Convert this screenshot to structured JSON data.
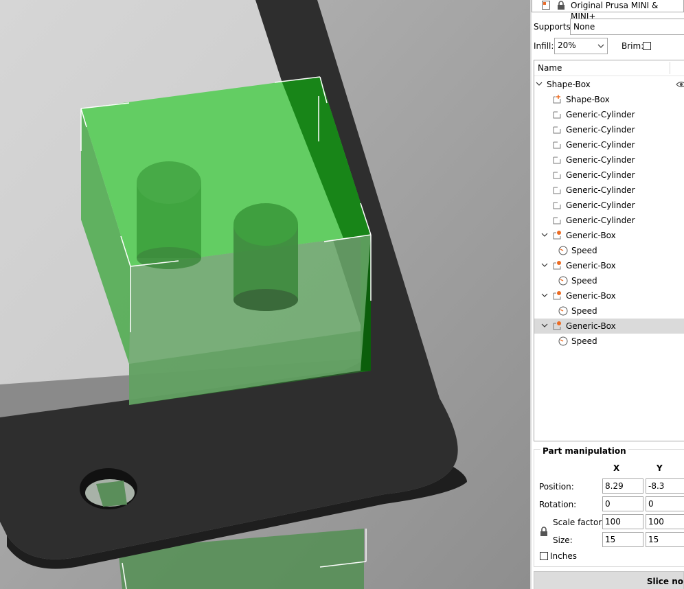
{
  "printer": {
    "name": "Original Prusa MINI & MINI+"
  },
  "supports": {
    "label": "Supports:",
    "value": "None"
  },
  "infill": {
    "label": "Infill:",
    "value": "20%"
  },
  "brim": {
    "label": "Brim:",
    "checked": false
  },
  "object_list": {
    "header": "Name",
    "items": [
      {
        "label": "Shape-Box",
        "type": "object"
      },
      {
        "label": "Shape-Box",
        "type": "part"
      },
      {
        "label": "Generic-Cylinder",
        "type": "modifier"
      },
      {
        "label": "Generic-Cylinder",
        "type": "modifier"
      },
      {
        "label": "Generic-Cylinder",
        "type": "modifier"
      },
      {
        "label": "Generic-Cylinder",
        "type": "modifier"
      },
      {
        "label": "Generic-Cylinder",
        "type": "modifier"
      },
      {
        "label": "Generic-Cylinder",
        "type": "modifier"
      },
      {
        "label": "Generic-Cylinder",
        "type": "modifier"
      },
      {
        "label": "Generic-Cylinder",
        "type": "modifier"
      },
      {
        "label": "Generic-Box",
        "type": "modifier-settings"
      },
      {
        "label": "Speed",
        "type": "setting"
      },
      {
        "label": "Generic-Box",
        "type": "modifier-settings"
      },
      {
        "label": "Speed",
        "type": "setting"
      },
      {
        "label": "Generic-Box",
        "type": "modifier-settings"
      },
      {
        "label": "Speed",
        "type": "setting"
      },
      {
        "label": "Generic-Box",
        "type": "modifier-settings",
        "selected": true
      },
      {
        "label": "Speed",
        "type": "setting"
      }
    ]
  },
  "part_manipulation": {
    "title": "Part manipulation",
    "col_x": "X",
    "col_y": "Y",
    "position_label": "Position:",
    "rotation_label": "Rotation:",
    "scale_label": "Scale factors:",
    "size_label": "Size:",
    "position": {
      "x": "8.29",
      "y": "-8.3"
    },
    "rotation": {
      "x": "0",
      "y": "0"
    },
    "scale": {
      "x": "100",
      "y": "100"
    },
    "size": {
      "x": "15",
      "y": "15"
    },
    "inches_label": "Inches",
    "inches_checked": false
  },
  "slice_button": {
    "label": "Slice no"
  },
  "colors": {
    "accent": "#ed6b21",
    "model_green": "#2fb12f",
    "bed": "#2e2e2e",
    "selection": "#dadada"
  }
}
